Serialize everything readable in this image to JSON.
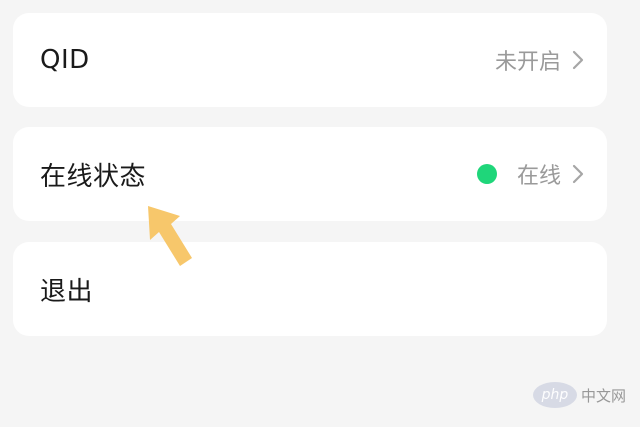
{
  "rows": {
    "qid": {
      "label": "QID",
      "value": "未开启"
    },
    "status": {
      "label": "在线状态",
      "value": "在线",
      "dot_color": "#1fd67a"
    },
    "logout": {
      "label": "退出"
    }
  },
  "annotation": {
    "arrow_color": "#f7c76b"
  },
  "watermark": {
    "logo_text": "php",
    "text": "中文网"
  },
  "icons": {
    "chevron": "chevron-right-icon",
    "status_dot": "online-status-dot-icon",
    "arrow": "pointer-arrow-icon"
  }
}
